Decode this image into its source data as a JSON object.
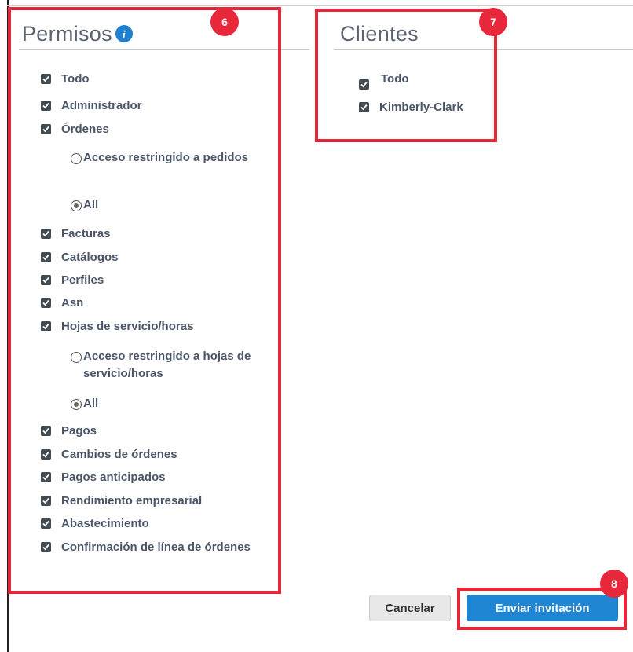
{
  "permissions": {
    "title": "Permisos",
    "items": [
      {
        "label": "Todo",
        "checked": true
      },
      {
        "label": "Administrador",
        "checked": true
      },
      {
        "label": "Órdenes",
        "checked": true
      },
      {
        "label": "Facturas",
        "checked": true
      },
      {
        "label": "Catálogos",
        "checked": true
      },
      {
        "label": "Perfiles",
        "checked": true
      },
      {
        "label": "Asn",
        "checked": true
      },
      {
        "label": "Hojas de servicio/horas",
        "checked": true
      },
      {
        "label": "Pagos",
        "checked": true
      },
      {
        "label": "Cambios de órdenes",
        "checked": true
      },
      {
        "label": "Pagos anticipados",
        "checked": true
      },
      {
        "label": "Rendimiento empresarial",
        "checked": true
      },
      {
        "label": "Abastecimiento",
        "checked": true
      },
      {
        "label": "Confirmación de línea de órdenes",
        "checked": true
      }
    ],
    "orders_options": [
      {
        "label": "Acceso restringido a pedidos",
        "checked": false
      },
      {
        "label": "All",
        "checked": true
      }
    ],
    "service_sheet_options": [
      {
        "label": "Acceso restringido a hojas de servicio/horas",
        "checked": false
      },
      {
        "label": "All",
        "checked": true
      }
    ]
  },
  "clients": {
    "title": "Clientes",
    "items": [
      {
        "label": "Todo",
        "checked": true
      },
      {
        "label": "Kimberly-Clark",
        "checked": true
      }
    ]
  },
  "badges": {
    "permissions": "6",
    "clients": "7",
    "send": "8"
  },
  "buttons": {
    "cancel": "Cancelar",
    "send": "Enviar invitación"
  },
  "colors": {
    "highlight": "#e8283a",
    "primary": "#1f86d3",
    "checkbox": "#424a52"
  }
}
